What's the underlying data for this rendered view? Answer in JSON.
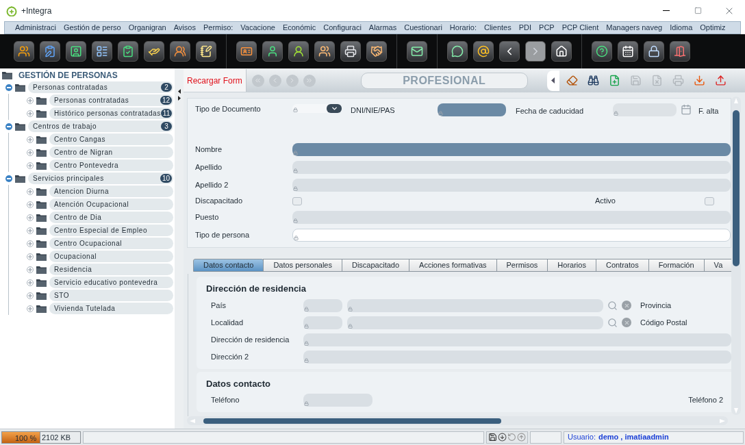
{
  "window": {
    "title": "+Integra"
  },
  "menu": [
    "Administraci",
    "Gestión de perso",
    "Organigran",
    "Avisos",
    "Permiso:",
    "Vacacione",
    "Económic",
    "Configuraci",
    "Alarmas",
    "Cuestionari",
    "Horario:",
    "Clientes",
    "PDI",
    "PCP",
    "PCP Client",
    "Managers naveg",
    "Idioma",
    "Optimiz"
  ],
  "toolbar": [
    [
      {
        "kind": "people",
        "disabled": false
      },
      {
        "kind": "clipboard-edit",
        "disabled": false
      },
      {
        "kind": "contact",
        "disabled": false
      },
      {
        "kind": "schedule",
        "disabled": false
      },
      {
        "kind": "checklist",
        "disabled": false
      },
      {
        "kind": "hand",
        "disabled": false
      },
      {
        "kind": "group",
        "disabled": false
      },
      {
        "kind": "notepad",
        "disabled": false
      }
    ],
    [
      {
        "kind": "id-card",
        "disabled": false
      },
      {
        "kind": "person",
        "disabled": false
      },
      {
        "kind": "worker",
        "disabled": false
      },
      {
        "kind": "family",
        "disabled": false
      },
      {
        "kind": "printer",
        "disabled": false
      },
      {
        "kind": "handshake",
        "disabled": false
      }
    ],
    [
      {
        "kind": "mail",
        "disabled": false
      }
    ],
    [
      {
        "kind": "chat",
        "disabled": false
      },
      {
        "kind": "at",
        "disabled": false
      },
      {
        "kind": "back",
        "disabled": false
      },
      {
        "kind": "forward",
        "disabled": true
      },
      {
        "kind": "home",
        "disabled": false
      }
    ],
    [
      {
        "kind": "help",
        "disabled": false
      },
      {
        "kind": "calendar",
        "disabled": false
      },
      {
        "kind": "lock",
        "disabled": false
      },
      {
        "kind": "exit",
        "disabled": false
      }
    ]
  ],
  "tree": {
    "title": "GESTIÓN DE PERSONAS",
    "items": [
      {
        "label": "Personas contratadas",
        "count": "2",
        "expanded": true,
        "children": [
          {
            "label": "Personas contratadas",
            "count": "12",
            "expanded": false
          },
          {
            "label": "Histórico personas contratadas",
            "count": "11",
            "expanded": false
          }
        ]
      },
      {
        "label": "Centros de trabajo",
        "count": "3",
        "expanded": true,
        "children": [
          {
            "label": "Centro Cangas",
            "expanded": false
          },
          {
            "label": "Centro de Nigran",
            "expanded": false
          },
          {
            "label": "Centro Pontevedra",
            "expanded": false
          }
        ]
      },
      {
        "label": "Servicios principales",
        "count": "10",
        "expanded": true,
        "children": [
          {
            "label": "Atencion Diurna",
            "expanded": false
          },
          {
            "label": "Atención Ocupacional",
            "expanded": false
          },
          {
            "label": "Centro de Dia",
            "expanded": false
          },
          {
            "label": "Centro Especial de Empleo",
            "expanded": false
          },
          {
            "label": "Centro Ocupacional",
            "expanded": false
          },
          {
            "label": "Ocupacional",
            "expanded": false
          },
          {
            "label": "Residencia",
            "expanded": false
          },
          {
            "label": "Servicio educativo pontevedra",
            "expanded": false
          },
          {
            "label": "STO",
            "expanded": false
          },
          {
            "label": "Vivienda Tutelada",
            "expanded": false
          }
        ]
      }
    ]
  },
  "form": {
    "reload_button": "Recargar Form",
    "record_nav": [
      {
        "kind": "first",
        "disabled": true
      },
      {
        "kind": "previous",
        "disabled": true
      },
      {
        "kind": "next",
        "disabled": true
      },
      {
        "kind": "last",
        "disabled": true
      }
    ],
    "title": "PROFESIONAL",
    "actions": [
      {
        "kind": "clear",
        "disabled": false
      },
      {
        "kind": "search",
        "disabled": false
      },
      {
        "kind": "new",
        "disabled": false
      },
      {
        "kind": "save",
        "disabled": true
      },
      {
        "kind": "delete",
        "disabled": true
      },
      {
        "kind": "print",
        "disabled": true
      },
      {
        "kind": "import",
        "disabled": false
      },
      {
        "kind": "export",
        "disabled": false
      }
    ],
    "document": {
      "type_label": "Tipo de Documento",
      "id_label": "DNI/NIE/PAS",
      "id_required": true,
      "expiry_label": "Fecha de caducidad",
      "start_label": "F. alta"
    },
    "fields": [
      {
        "kind": "text",
        "label": "Nombre",
        "required": true,
        "editable": false
      },
      {
        "kind": "text",
        "label": "Apellido",
        "required": false,
        "editable": false
      },
      {
        "kind": "text",
        "label": "Apellido 2",
        "required": false,
        "editable": false
      },
      {
        "kind": "checkboxes",
        "items": [
          {
            "label": "Discapacitado",
            "checked": false
          },
          {
            "label": "Activo",
            "checked": false
          }
        ]
      },
      {
        "kind": "text",
        "label": "Puesto",
        "required": false,
        "editable": false
      },
      {
        "kind": "text",
        "label": "Tipo de persona",
        "required": false,
        "editable": true
      }
    ],
    "tabs": [
      {
        "label": "Datos contacto",
        "selected": true
      },
      {
        "label": "Datos personales",
        "selected": false
      },
      {
        "label": "Discapacitado",
        "selected": false
      },
      {
        "label": "Acciones formativas",
        "selected": false
      },
      {
        "label": "Permisos",
        "selected": false
      },
      {
        "label": "Horarios",
        "selected": false
      },
      {
        "label": "Contratos",
        "selected": false
      },
      {
        "label": "Formación",
        "selected": false
      },
      {
        "label": "Va",
        "selected": false
      }
    ],
    "sections": [
      {
        "title": "Dirección de residencia",
        "rows": [
          {
            "kind": "lookup",
            "label": "País",
            "side_label": "Provincia"
          },
          {
            "kind": "lookup",
            "label": "Localidad",
            "side_label": "Código Postal"
          },
          {
            "kind": "text",
            "label": "Dirección de residencia"
          },
          {
            "kind": "text",
            "label": "Dirección 2"
          }
        ]
      },
      {
        "title": "Datos contacto",
        "rows": [
          {
            "kind": "short",
            "label": "Teléfono",
            "side_label": "Teléfono 2"
          }
        ]
      }
    ]
  },
  "status": {
    "memory": {
      "reading": "100 %",
      "level": 1
    },
    "size": "2102 KB",
    "user_label": "Usuario:",
    "user": "demo , imatiaadmin"
  }
}
